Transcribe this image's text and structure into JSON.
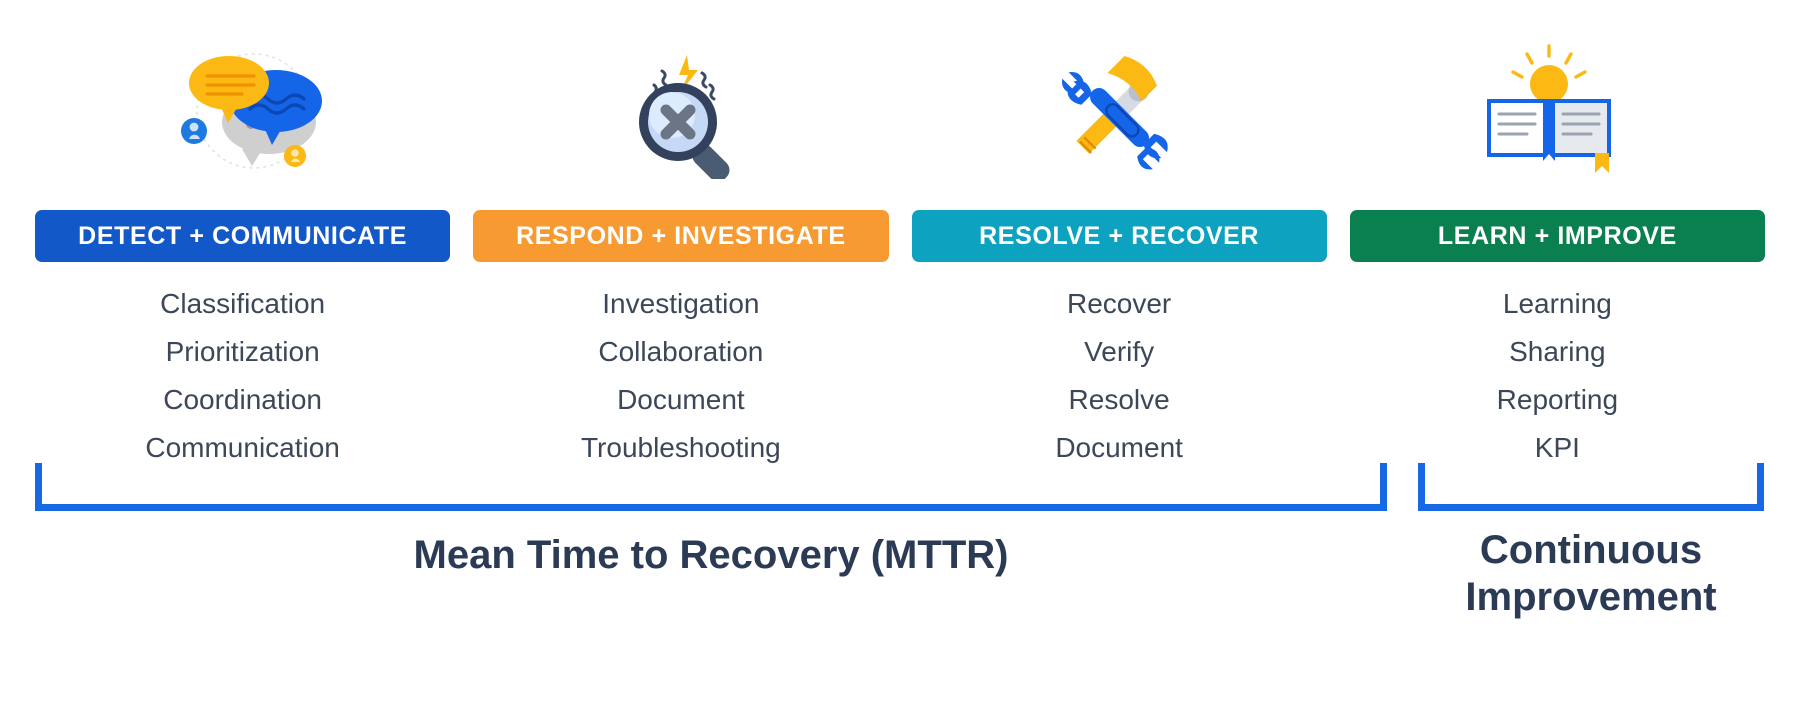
{
  "colors": {
    "detect": "#1258c8",
    "respond": "#f89a32",
    "resolve": "#0ca2c0",
    "learn": "#0a8050",
    "bracket": "#1668e3",
    "body_text": "#3c4758",
    "caption_text": "#2b3a55"
  },
  "columns": [
    {
      "id": "detect-communicate",
      "icon": "speech-bubbles-icon",
      "banner": "DETECT + COMMUNICATE",
      "banner_color": "#1258c8",
      "items": [
        "Classification",
        "Prioritization",
        "Coordination",
        "Communication"
      ]
    },
    {
      "id": "respond-investigate",
      "icon": "magnifier-error-icon",
      "banner": "RESPOND + INVESTIGATE",
      "banner_color": "#f89a32",
      "items": [
        "Investigation",
        "Collaboration",
        "Document",
        "Troubleshooting"
      ]
    },
    {
      "id": "resolve-recover",
      "icon": "hammer-wrench-icon",
      "banner": "RESOLVE + RECOVER",
      "banner_color": "#0ca2c0",
      "items": [
        "Recover",
        "Verify",
        "Resolve",
        "Document"
      ]
    },
    {
      "id": "learn-improve",
      "icon": "lightbulb-book-icon",
      "banner": "LEARN + IMPROVE",
      "banner_color": "#0a8050",
      "items": [
        "Learning",
        "Sharing",
        "Reporting",
        "KPI"
      ]
    }
  ],
  "brackets": [
    {
      "id": "mttr-bracket",
      "caption": "Mean Time to Recovery (MTTR)"
    },
    {
      "id": "continuous-improvement-bracket",
      "caption_line1": "Continuous",
      "caption_line2": "Improvement"
    }
  ]
}
